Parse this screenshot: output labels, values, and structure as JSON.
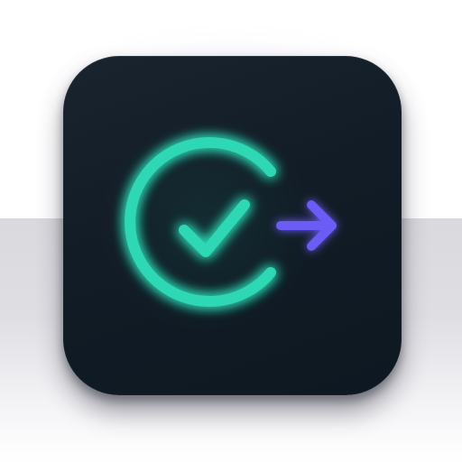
{
  "icon": {
    "name": "check-circle-arrow-icon",
    "colors": {
      "background": "#121c26",
      "check_ring": "#2fd8b4",
      "glow": "#1fbf9c",
      "arrow": "#6a5cf5"
    }
  }
}
